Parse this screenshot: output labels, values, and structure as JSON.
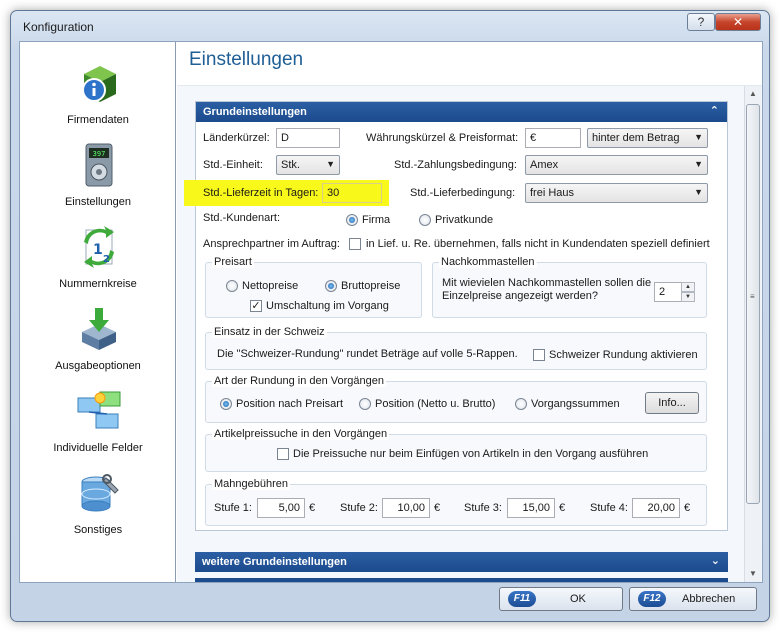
{
  "window": {
    "title": "Konfiguration",
    "help_label": "?",
    "close_label": "✕"
  },
  "sidebar": {
    "items": [
      {
        "label": "Firmendaten",
        "icon": "info-cube-icon"
      },
      {
        "label": "Einstellungen",
        "icon": "device-settings-icon"
      },
      {
        "label": "Nummernkreise",
        "icon": "numbering-icon"
      },
      {
        "label": "Ausgabeoptionen",
        "icon": "output-icon"
      },
      {
        "label": "Individuelle Felder",
        "icon": "custom-fields-icon"
      },
      {
        "label": "Sonstiges",
        "icon": "database-tools-icon"
      }
    ]
  },
  "content": {
    "title": "Einstellungen"
  },
  "grund": {
    "title": "Grundeinstellungen",
    "laenderkuerzel_label": "Länderkürzel:",
    "laenderkuerzel_value": "D",
    "waehrung_label": "Währungskürzel & Preisformat:",
    "waehrung_value": "€",
    "preisformat_value": "hinter dem Betrag",
    "einheit_label": "Std.-Einheit:",
    "einheit_value": "Stk.",
    "zahlung_label": "Std.-Zahlungsbedingung:",
    "zahlung_value": "Amex",
    "lieferzeit_label": "Std.-Lieferzeit in Tagen:",
    "lieferzeit_value": "30",
    "liefer_label": "Std.-Lieferbedingung:",
    "liefer_value": "frei Haus",
    "kundenart_label": "Std.-Kundenart:",
    "kundenart_firma": "Firma",
    "kundenart_privat": "Privatkunde",
    "ansprech_label": "Ansprechpartner im Auftrag:",
    "ansprech_check": "in Lief. u. Re. übernehmen, falls nicht in Kundendaten speziell definiert",
    "highlight_color": "#f8f81a"
  },
  "preisart": {
    "title": "Preisart",
    "netto": "Nettopreise",
    "brutto": "Bruttopreise",
    "umschaltung": "Umschaltung im Vorgang"
  },
  "nachkomma": {
    "title": "Nachkommastellen",
    "question": "Mit wievielen Nachkommastellen sollen die Einzelpreise angezeigt werden?",
    "value": "2"
  },
  "schweiz": {
    "title": "Einsatz in der Schweiz",
    "text": "Die \"Schweizer-Rundung\" rundet Beträge auf volle 5-Rappen.",
    "check": "Schweizer Rundung aktivieren"
  },
  "rundung": {
    "title": "Art der Rundung in den Vorgängen",
    "opt1": "Position nach Preisart",
    "opt2": "Position (Netto u. Brutto)",
    "opt3": "Vorgangssummen",
    "info_button": "Info..."
  },
  "artikel": {
    "title": "Artikelpreissuche in den Vorgängen",
    "check": "Die Preissuche nur beim Einfügen von Artikeln in den Vorgang ausführen"
  },
  "mahn": {
    "title": "Mahngebühren",
    "currency": "€",
    "stufen": [
      {
        "label": "Stufe 1:",
        "value": "5,00"
      },
      {
        "label": "Stufe 2:",
        "value": "10,00"
      },
      {
        "label": "Stufe 3:",
        "value": "15,00"
      },
      {
        "label": "Stufe 4:",
        "value": "20,00"
      }
    ]
  },
  "weitere": {
    "title": "weitere Grundeinstellungen"
  },
  "footer": {
    "ok_key": "F11",
    "ok_label": "OK",
    "cancel_key": "F12",
    "cancel_label": "Abbrechen"
  }
}
